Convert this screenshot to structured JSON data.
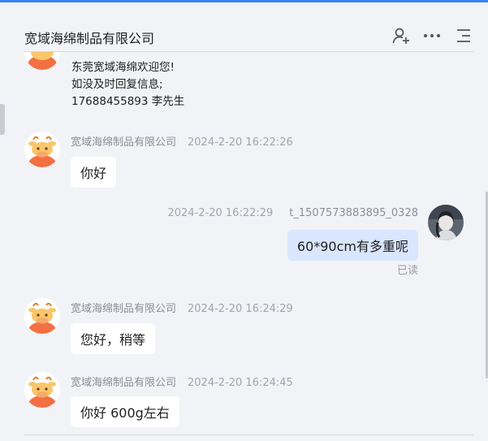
{
  "header": {
    "title": "宽域海绵制品有限公司",
    "icons": [
      "add-user-icon",
      "more-icon",
      "list-menu-icon"
    ]
  },
  "welcome": {
    "lines": [
      "东莞宽域海绵欢迎您!",
      "如没及时回复信息;",
      "17688455893 李先生"
    ]
  },
  "messages": [
    {
      "sender": "宽域海绵制品有限公司",
      "time": "2024-2-20 16:22:26",
      "text": "你好",
      "mine": false
    },
    {
      "sender": "t_1507573883895_0328",
      "time": "2024-2-20 16:22:29",
      "text": "60*90cm有多重呢",
      "mine": true,
      "status": "已读"
    },
    {
      "sender": "宽域海绵制品有限公司",
      "time": "2024-2-20 16:24:29",
      "text": "您好，稍等",
      "mine": false
    },
    {
      "sender": "宽域海绵制品有限公司",
      "time": "2024-2-20 16:24:45",
      "text": "你好 600g左右",
      "mine": false
    }
  ],
  "colors": {
    "accent": "#3b82f6",
    "mine_bubble": "#d9e6fd",
    "background": "#f2f3f7"
  }
}
